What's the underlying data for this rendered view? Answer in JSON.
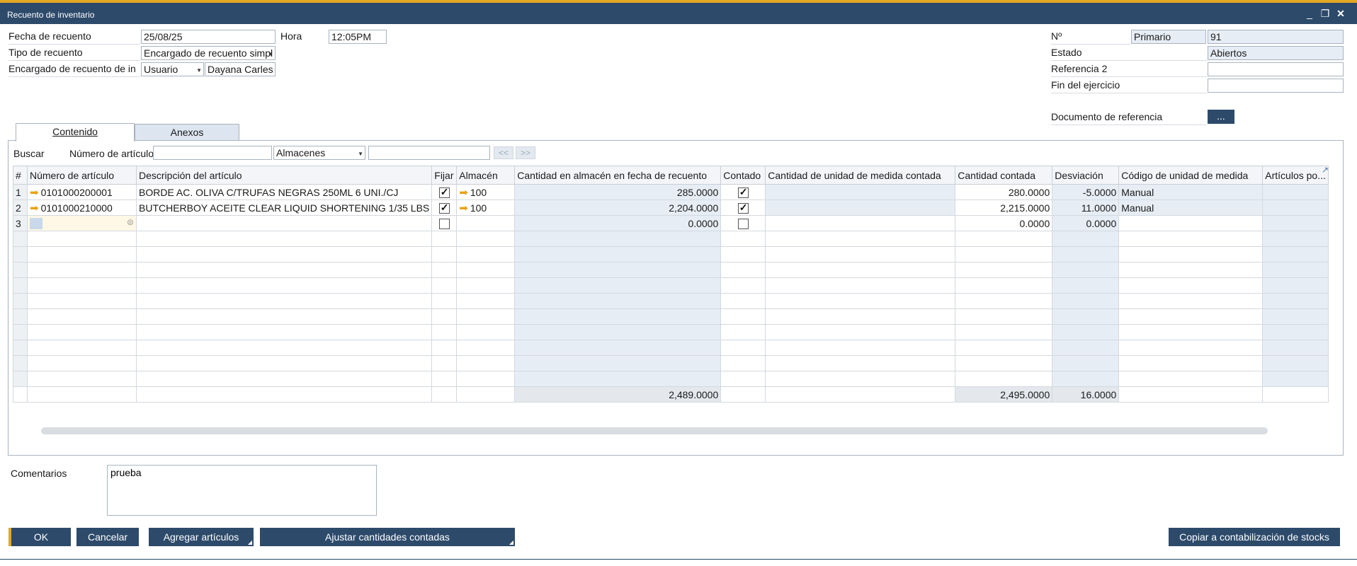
{
  "window": {
    "title": "Recuento de inventario"
  },
  "header": {
    "fecha_label": "Fecha de recuento",
    "fecha_value": "25/08/25",
    "hora_label": "Hora",
    "hora_value": "12:05PM",
    "tipo_label": "Tipo de recuento",
    "tipo_value": "Encargado de recuento simpl",
    "encargado_label": "Encargado de recuento de in",
    "encargado_type": "Usuario",
    "encargado_name": "Dayana Carles",
    "no_label": "Nº",
    "no_series": "Primario",
    "no_value": "91",
    "estado_label": "Estado",
    "estado_value": "Abiertos",
    "ref2_label": "Referencia 2",
    "ref2_value": "",
    "fin_label": "Fin del ejercicio",
    "fin_value": "",
    "docref_label": "Documento de referencia",
    "docref_button": "..."
  },
  "tabs": [
    {
      "label": "Contenido",
      "active": true
    },
    {
      "label": "Anexos",
      "active": false
    }
  ],
  "search": {
    "buscar_label": "Buscar",
    "articulo_label": "Número de artículo",
    "articulo_value": "",
    "almacenes_value": "Almacenes",
    "almacenes_search": "",
    "prev": "<<",
    "next": ">>"
  },
  "grid": {
    "columns": [
      "#",
      "Número de artículo",
      "Descripción del artículo",
      "Fijar",
      "Almacén",
      "Cantidad en almacén en fecha de recuento",
      "Contado",
      "Cantidad de unidad de medida contada",
      "Cantidad contada",
      "Desviación",
      "Código de unidad de medida",
      "Artículos po..."
    ],
    "rows": [
      {
        "n": "1",
        "item": "0101000200001",
        "desc": "BORDE AC. OLIVA C/TRUFAS NEGRAS 250ML 6 UNI./CJ",
        "fijar": true,
        "almacen": "100",
        "qty": "285.0000",
        "contado": true,
        "uom_qty": "",
        "counted": "280.0000",
        "dev": "-5.0000",
        "uom": "Manual"
      },
      {
        "n": "2",
        "item": "0101000210000",
        "desc": "BUTCHERBOY ACEITE CLEAR LIQUID SHORTENING  1/35 LBS",
        "fijar": true,
        "almacen": "100",
        "qty": "2,204.0000",
        "contado": true,
        "uom_qty": "",
        "counted": "2,215.0000",
        "dev": "11.0000",
        "uom": "Manual"
      },
      {
        "n": "3",
        "item": "",
        "desc": "",
        "fijar": false,
        "almacen": "",
        "qty": "0.0000",
        "contado": false,
        "uom_qty": "",
        "counted": "0.0000",
        "dev": "0.0000",
        "uom": ""
      }
    ],
    "totals": {
      "qty": "2,489.0000",
      "counted": "2,495.0000",
      "dev": "16.0000"
    }
  },
  "comments": {
    "label": "Comentarios",
    "value": "prueba"
  },
  "buttons": {
    "ok": "OK",
    "cancel": "Cancelar",
    "add": "Agregar artículos",
    "adjust": "Ajustar cantidades contadas",
    "copy": "Copiar a contabilización de stocks"
  },
  "colors": {
    "titlebar": "#2d4a6b",
    "accent": "#e4a825",
    "readonly": "#e6edf5"
  }
}
